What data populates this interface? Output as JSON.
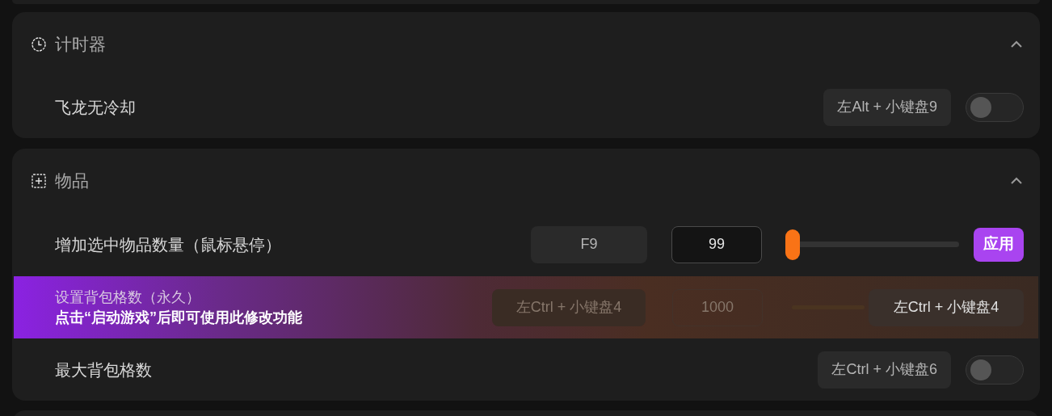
{
  "sections": [
    {
      "title": "计时器",
      "expanded": true,
      "rows": [
        {
          "kind": "toggle",
          "label": "飞龙无冷却",
          "hotkey": "左Alt + 小键盘9",
          "on": false
        }
      ]
    },
    {
      "title": "物品",
      "expanded": true,
      "rows": [
        {
          "kind": "slider",
          "label": "增加选中物品数量（鼠标悬停）",
          "hotkey": "F9",
          "value": "99",
          "level": 0,
          "button": "应用"
        },
        {
          "kind": "locked",
          "label": "设置背包格数（永久）",
          "notice": "点击“启动游戏”后即可使用此修改功能",
          "hotkey": "左Ctrl + 小键盘4",
          "value": "1000",
          "overlay_hotkey": "左Ctrl + 小键盘4"
        },
        {
          "kind": "toggle",
          "label": "最大背包格数",
          "hotkey": "左Ctrl + 小键盘6",
          "on": false
        }
      ]
    }
  ]
}
